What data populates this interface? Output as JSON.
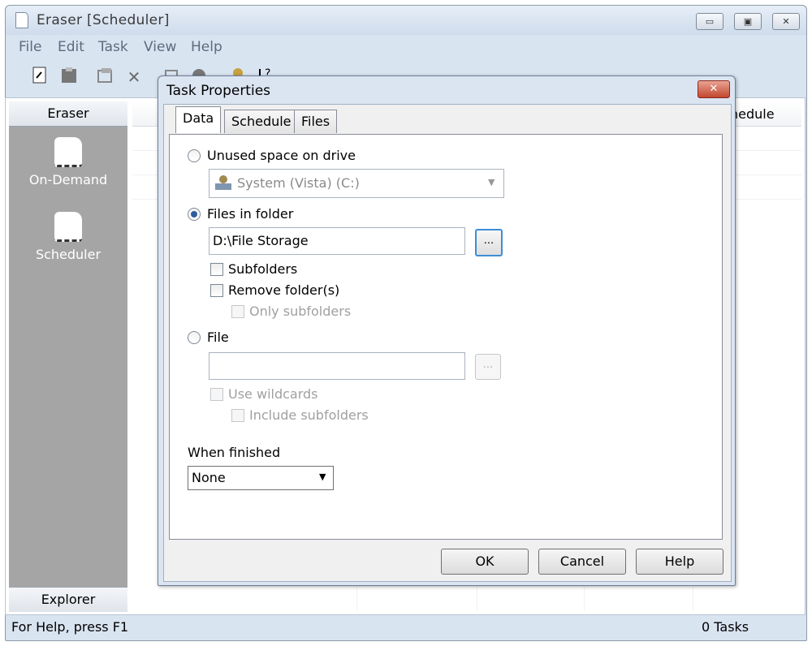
{
  "window": {
    "title": "Eraser  [Scheduler]",
    "controls": {
      "minimize": "▭",
      "maximize": "▣",
      "close": "✕"
    }
  },
  "menu": [
    "File",
    "Edit",
    "Task",
    "View",
    "Help"
  ],
  "sidebar": {
    "header": "Eraser",
    "items": [
      {
        "label": "On-Demand",
        "icon": "eraser-icon"
      },
      {
        "label": "Scheduler",
        "icon": "scheduler-icon"
      }
    ],
    "footer": "Explorer"
  },
  "list": {
    "visible_column": "hedule"
  },
  "status": {
    "help": "For Help, press F1",
    "tasks": "0 Tasks"
  },
  "dialog": {
    "title": "Task Properties",
    "close_symbol": "✕",
    "tabs": [
      "Data",
      "Schedule",
      "Files"
    ],
    "unused_space": {
      "label": "Unused space on drive",
      "drive": "System (Vista) (C:)",
      "selected": false
    },
    "files_in_folder": {
      "label": "Files in folder",
      "selected": true,
      "path": "D:\\File Storage",
      "browse": "...",
      "subfolders": "Subfolders",
      "remove_folders": "Remove folder(s)",
      "only_subfolders": "Only subfolders"
    },
    "file": {
      "label": "File",
      "selected": false,
      "path": "",
      "browse": "...",
      "use_wildcards": "Use wildcards",
      "include_subfolders": "Include subfolders"
    },
    "when_finished": {
      "label": "When finished",
      "value": "None"
    },
    "buttons": {
      "ok": "OK",
      "cancel": "Cancel",
      "help": "Help"
    }
  }
}
